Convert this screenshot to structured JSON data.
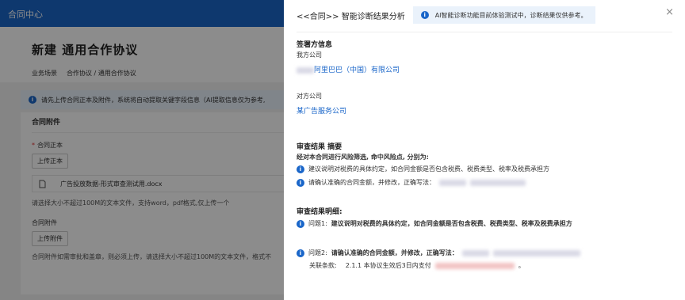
{
  "topbar": {
    "title": "合同中心"
  },
  "page": {
    "title": "新建  通用合作协议",
    "crumb_label": "业务场景",
    "crumb_value": "合作协议 / 通用合作协议"
  },
  "notice": {
    "text": "请先上传合同正本及附件，系统将自动提取关键字段信息（AI提取信息仅为参考,"
  },
  "attachments": {
    "title": "合同附件",
    "main_label": "合同正本",
    "upload_main": "上传正本",
    "file_name": "广告投放数据-形式审查测试用.docx",
    "hint_main": "请选择大小不超过100M的文本文件，支持word，pdf格式,仅上传一个",
    "attach_label": "合同附件",
    "upload_attach": "上传附件",
    "hint_attach": "合同附件如需审批和盖章，则必须上传，请选择大小不超过100M的文本文件，格式不"
  },
  "drawer": {
    "title": "<<合同>> 智能诊断结果分析",
    "note": "AI智能诊断功能目前体验测试中，诊断结果仅供参考。",
    "close": "×",
    "signers": {
      "heading": "签署方信息",
      "our_label": "我方公司",
      "our_company": "阿里巴巴（中国）有限公司",
      "other_label": "对方公司",
      "other_company": "某广告服务公司"
    },
    "summary": {
      "heading": "审查结果 摘要",
      "intro": "经对本合同进行风险筛选, 命中风险点, 分别为:",
      "item1": "建议说明对税费的具体约定，如合同金额是否包含税费、税费类型、税率及税费承担方",
      "item2": "请确认准确的合同金额，并修改，正确写法："
    },
    "detail": {
      "heading": "审查结果明细:",
      "q1_label": "问题1:",
      "q1_text": "建议说明对税费的具体约定，如合同金额是否包含税费、税费类型、税率及税费承担方",
      "q2_label": "问题2:",
      "q2_text": "请确认准确的合同金额，并修改，正确写法：",
      "clause_label": "关联条款:",
      "clause_text": "2.1.1 本协议生效后3日内支付",
      "clause_end": "。"
    }
  },
  "colors": {
    "accent": "#1a66c9",
    "required": "#e03030"
  }
}
